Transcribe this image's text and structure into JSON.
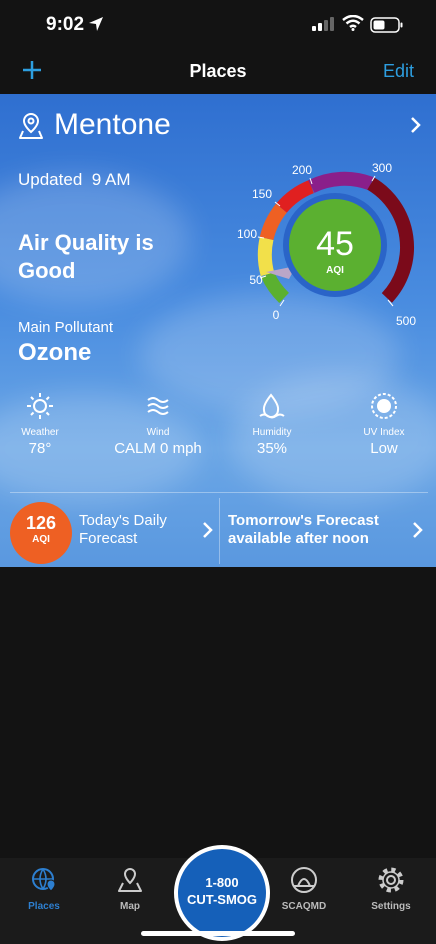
{
  "status": {
    "time": "9:02"
  },
  "nav": {
    "title": "Places",
    "edit": "Edit"
  },
  "location": {
    "name": "Mentone",
    "updated_label": "Updated",
    "updated_time": "9 AM"
  },
  "air_quality": {
    "title": "Air Quality is Good",
    "main_pollutant_label": "Main Pollutant",
    "main_pollutant": "Ozone"
  },
  "gauge": {
    "value": "45",
    "unit": "AQI",
    "ticks": [
      "0",
      "50",
      "100",
      "150",
      "200",
      "300",
      "500"
    ]
  },
  "conditions": [
    {
      "label": "Weather",
      "value": "78°",
      "icon": "sun-icon"
    },
    {
      "label": "Wind",
      "value": "CALM 0 mph",
      "icon": "wind-icon"
    },
    {
      "label": "Humidity",
      "value": "35%",
      "icon": "humidity-icon"
    },
    {
      "label": "UV Index",
      "value": "Low",
      "icon": "uv-icon"
    }
  ],
  "forecast": {
    "today_value": "126",
    "today_unit": "AQI",
    "today_label": "Today's Daily Forecast",
    "tomorrow_label": "Tomorrow's Forecast available after noon"
  },
  "tabs": [
    {
      "label": "Places",
      "active": true
    },
    {
      "label": "Map"
    },
    {
      "label": "SCAQMD"
    },
    {
      "label": "Settings"
    }
  ],
  "hotline": {
    "line1": "1-800",
    "line2": "CUT-SMOG"
  },
  "colors": {
    "accent": "#2d9ee0",
    "good": "#5bb030",
    "unhealthy_sensitive": "#ee6023",
    "hotline": "#1560b9"
  }
}
